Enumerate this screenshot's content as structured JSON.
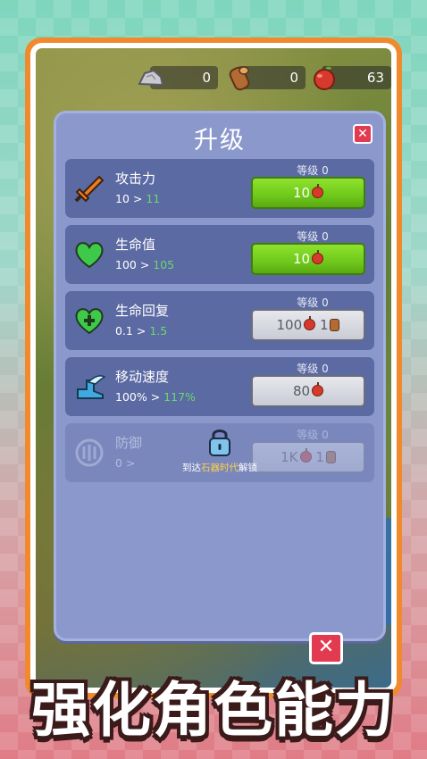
{
  "resources": [
    {
      "name": "stone",
      "icon": "stone-icon",
      "value": "0"
    },
    {
      "name": "wood",
      "icon": "wood-log-icon",
      "value": "0"
    },
    {
      "name": "apple",
      "icon": "apple-icon",
      "value": "63"
    }
  ],
  "panel": {
    "title": "升级",
    "close_icon": "close-icon"
  },
  "upgrades": [
    {
      "name": "攻击力",
      "icon": "sword-icon",
      "current": "10",
      "next": "11",
      "level": "等级 0",
      "cost": "10",
      "cost_items": [
        "apple"
      ],
      "enabled": true
    },
    {
      "name": "生命值",
      "icon": "heart-icon",
      "current": "100",
      "next": "105",
      "level": "等级 0",
      "cost": "10",
      "cost_items": [
        "apple"
      ],
      "enabled": true
    },
    {
      "name": "生命回复",
      "icon": "heart-plus-icon",
      "current": "0.1",
      "next": "1.5",
      "level": "等级 0",
      "cost": "100",
      "cost2": "1",
      "cost_items": [
        "apple",
        "wood"
      ],
      "enabled": false
    },
    {
      "name": "移动速度",
      "icon": "winged-boot-icon",
      "current": "100%",
      "next": "117%",
      "level": "等级 0",
      "cost": "80",
      "cost_items": [
        "apple"
      ],
      "enabled": false
    },
    {
      "name": "防御",
      "icon": "shield-icon",
      "current": "0",
      "next": "",
      "level": "等级 0",
      "cost": "1K",
      "cost2": "1",
      "cost_items": [
        "apple",
        "wood"
      ],
      "enabled": false,
      "locked": true
    }
  ],
  "lock": {
    "prefix": "到达",
    "era": "石器时代",
    "suffix": "解锁"
  },
  "banner": "强化角色能力",
  "colors": {
    "accent_green": "#6fc81b",
    "panel": "#8a98cc",
    "row": "#5c6aa3",
    "close_red": "#e23b51",
    "frame_orange": "#f08a2c"
  }
}
